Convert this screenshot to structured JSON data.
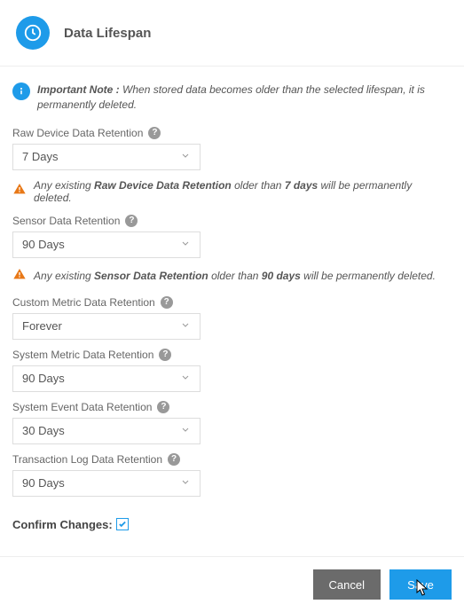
{
  "header": {
    "title": "Data Lifespan"
  },
  "info": {
    "label": "Important Note :",
    "text": "When stored data becomes older than the selected lifespan, it is permanently deleted."
  },
  "fields": {
    "raw": {
      "label": "Raw Device Data Retention",
      "value": "7 Days"
    },
    "sensor": {
      "label": "Sensor Data Retention",
      "value": "90 Days"
    },
    "custom": {
      "label": "Custom Metric Data Retention",
      "value": "Forever"
    },
    "sysmet": {
      "label": "System Metric Data Retention",
      "value": "90 Days"
    },
    "sysevt": {
      "label": "System Event Data Retention",
      "value": "30 Days"
    },
    "txlog": {
      "label": "Transaction Log Data Retention",
      "value": "90 Days"
    }
  },
  "warnings": {
    "raw": {
      "prefix": "Any existing ",
      "subject": "Raw Device Data Retention",
      "mid": " older than ",
      "period": "7 days",
      "suffix": " will be permanently deleted."
    },
    "sensor": {
      "prefix": "Any existing ",
      "subject": "Sensor Data Retention",
      "mid": " older than ",
      "period": "90 days",
      "suffix": " will be permanently deleted."
    }
  },
  "confirm": {
    "label": "Confirm Changes:",
    "checked": true
  },
  "buttons": {
    "cancel": "Cancel",
    "save": "Save"
  }
}
